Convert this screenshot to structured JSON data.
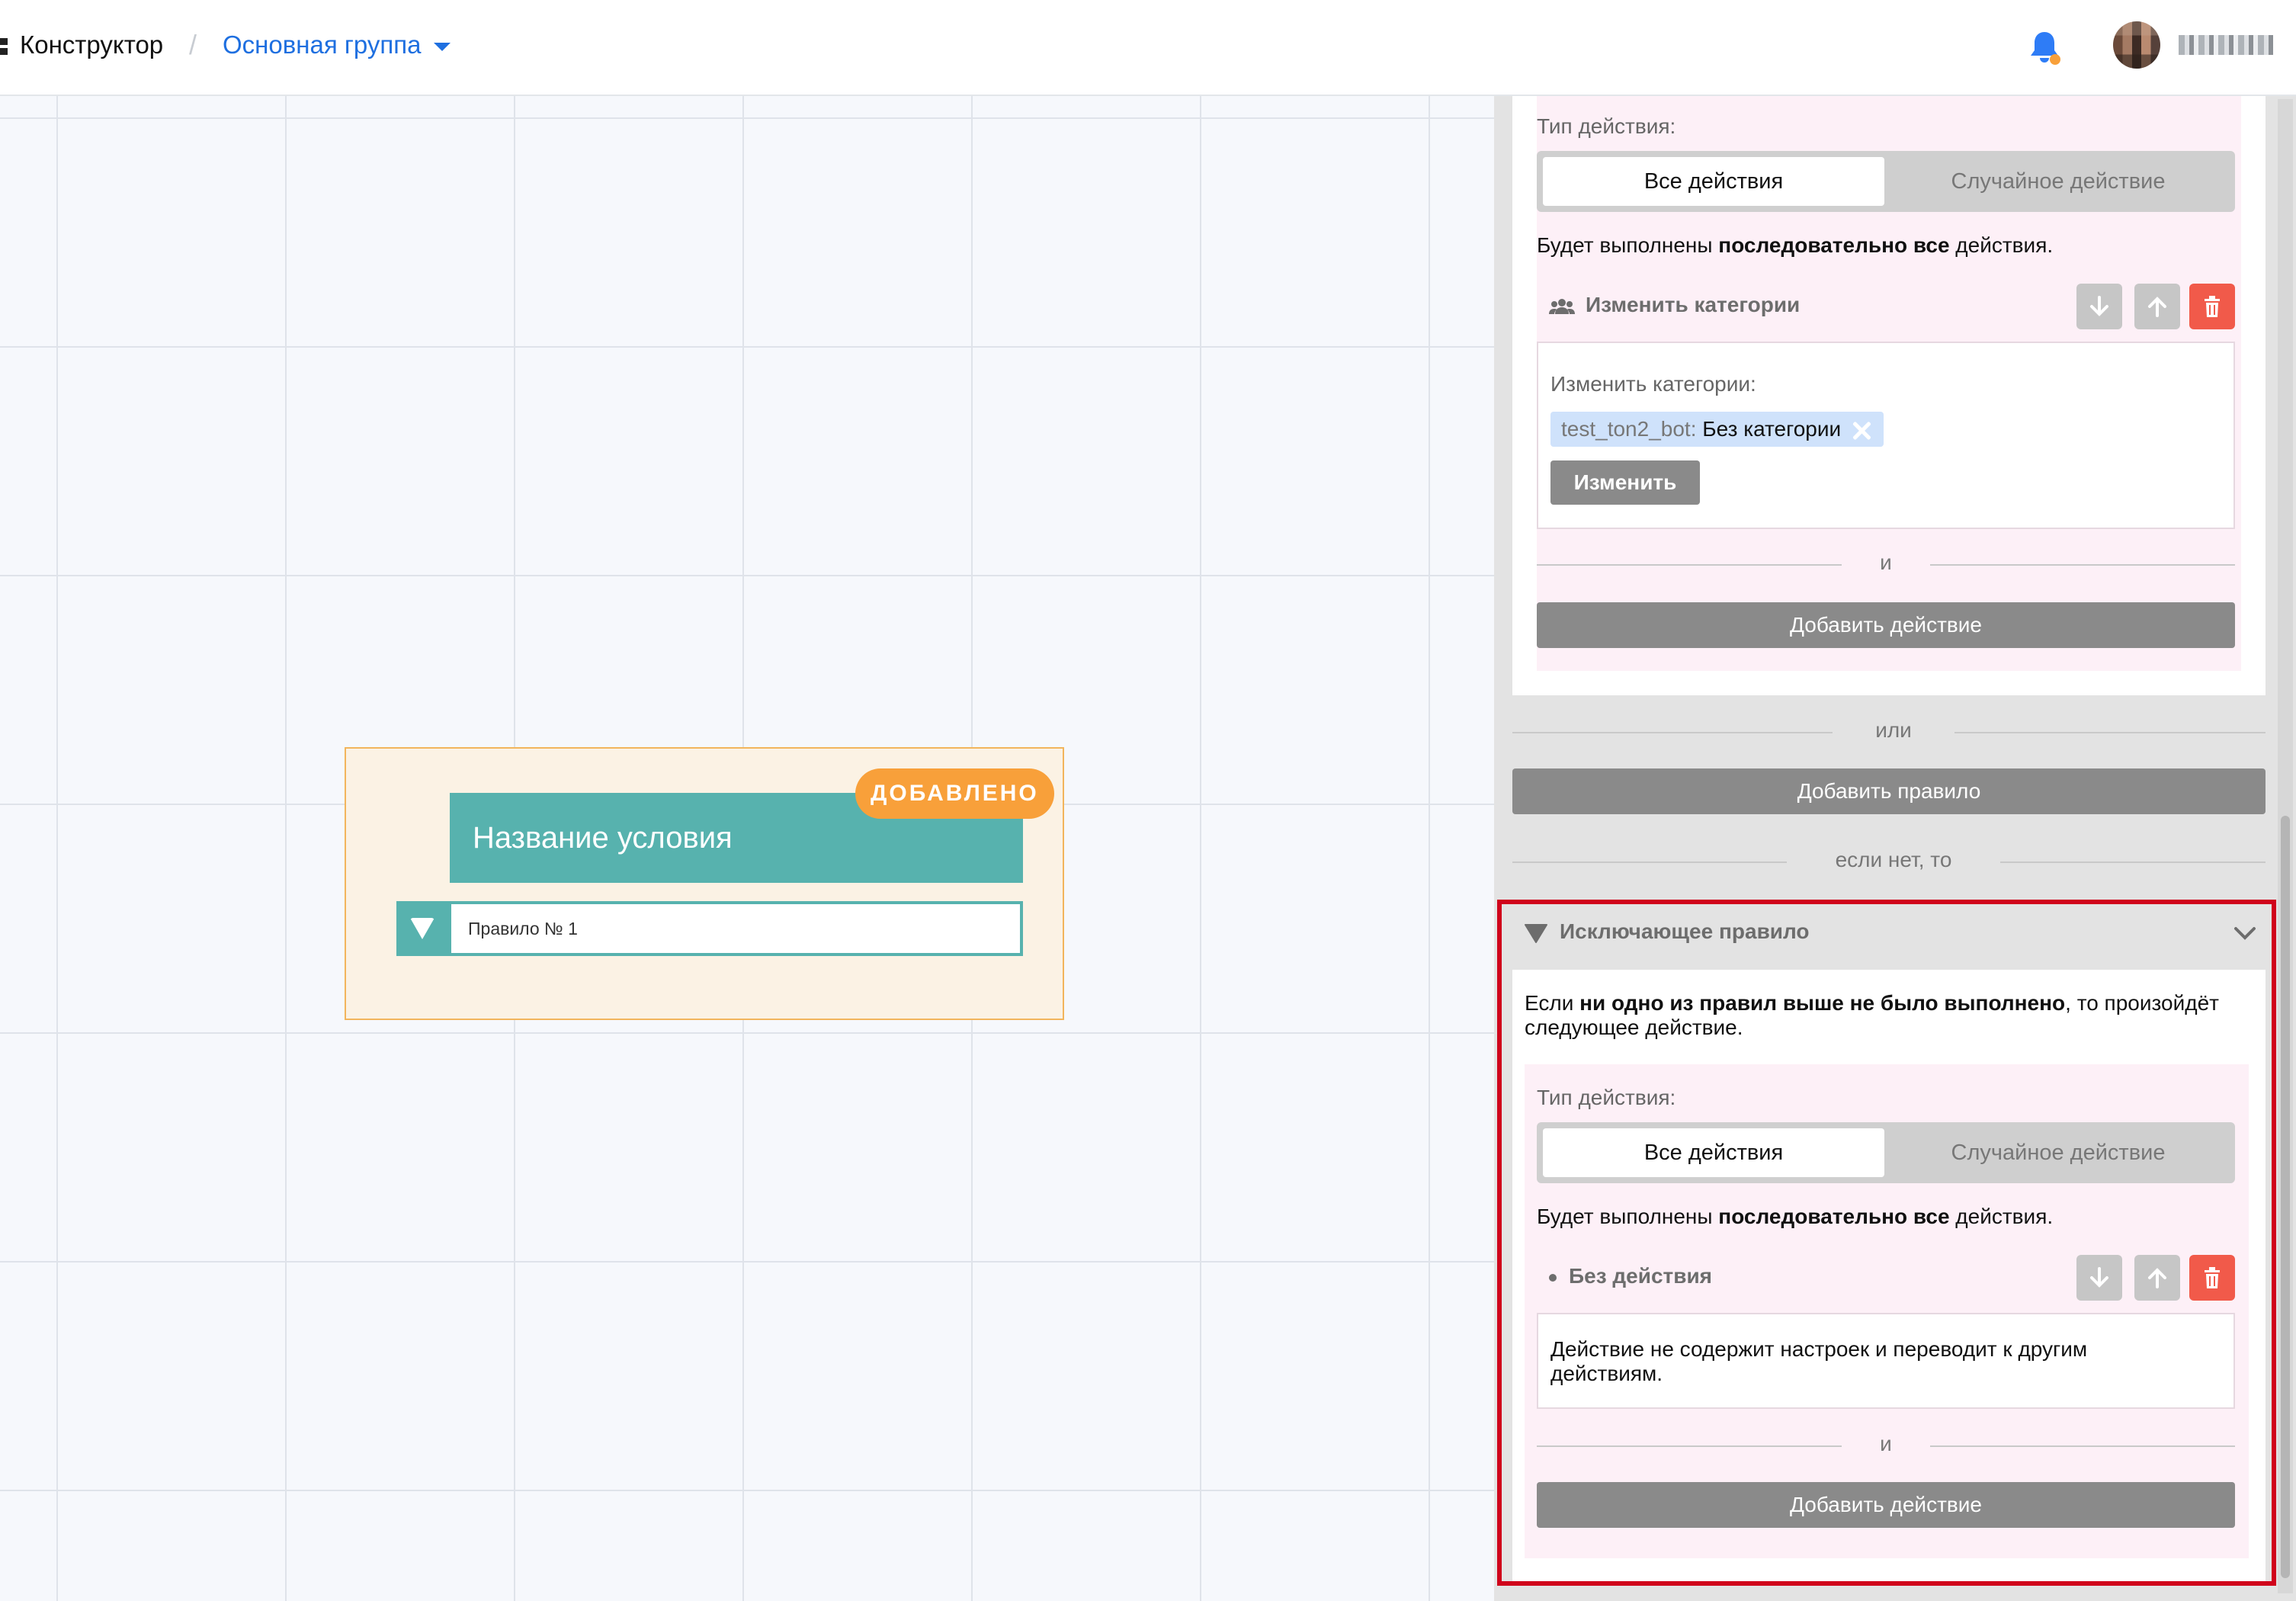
{
  "header": {
    "app_title": "Конструктор",
    "separator": "/",
    "group": "Основная группа"
  },
  "canvas": {
    "node": {
      "title": "Название условия",
      "badge": "ДОБАВЛЕНО",
      "rule_label": "Правило № 1"
    }
  },
  "panel": {
    "rule_card": {
      "action_type_label": "Тип действия:",
      "seg_all": "Все действия",
      "seg_random": "Случайное действие",
      "desc_prefix": "Будет выполнены ",
      "desc_bold": "последовательно все",
      "desc_suffix": " действия.",
      "action_title": "Изменить категории",
      "action_field_label": "Изменить категории:",
      "chip_prefix": "test_ton2_bot:",
      "chip_value": " Без категории",
      "change_button": "Изменить",
      "and_label": "и",
      "add_action_button": "Добавить действие"
    },
    "or_label": "или",
    "add_rule_button": "Добавить правило",
    "else_label": "если нет, то",
    "exclusive": {
      "title": "Исключающее правило",
      "desc_prefix": "Если ",
      "desc_bold": "ни одно из правил выше не было выполнено",
      "desc_suffix": ", то произойдёт",
      "desc_line2": "следующее действие.",
      "action_type_label": "Тип действия:",
      "seg_all": "Все действия",
      "seg_random": "Случайное действие",
      "run_prefix": "Будет выполнены ",
      "run_bold": "последовательно все",
      "run_suffix": " действия.",
      "action_title": "Без действия",
      "action_desc_line1": "Действие не содержит настроек и переводит к другим",
      "action_desc_line2": "действиям.",
      "and_label": "и",
      "add_action_button": "Добавить действие"
    }
  },
  "colors": {
    "accent": "#1e6fe0",
    "node_teal": "#57b2ae",
    "badge_orange": "#f8a03a",
    "delete_red": "#f15a4a",
    "highlight_red": "#d0021b"
  }
}
